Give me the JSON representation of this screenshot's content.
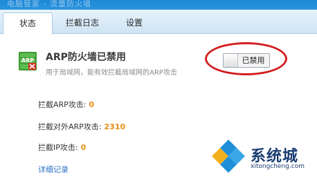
{
  "titlebar": {
    "text": "电脑管家 - 流量防火墙"
  },
  "tabs": [
    {
      "label": "状态"
    },
    {
      "label": "拦截日志"
    },
    {
      "label": "设置"
    }
  ],
  "arp": {
    "icon_text": "ARP",
    "title": "ARP防火墙已禁用",
    "description": "用于局域网，能有效拦截局域网的ARP攻击",
    "toggle_label": "已禁用",
    "highlight_color": "#d41d1d"
  },
  "stats": [
    {
      "label": "拦截ARP攻击:",
      "value": "0"
    },
    {
      "label": "拦截对外ARP攻击:",
      "value": "2310"
    },
    {
      "label": "拦截IP攻击:",
      "value": "0"
    }
  ],
  "details_link": "详细记录",
  "watermark": {
    "text": "系统城",
    "sub": "xitongcheng.com"
  },
  "colors": {
    "accent_blue": "#1b87d6",
    "stat_value": "#e98e12",
    "link": "#2a73c7"
  }
}
